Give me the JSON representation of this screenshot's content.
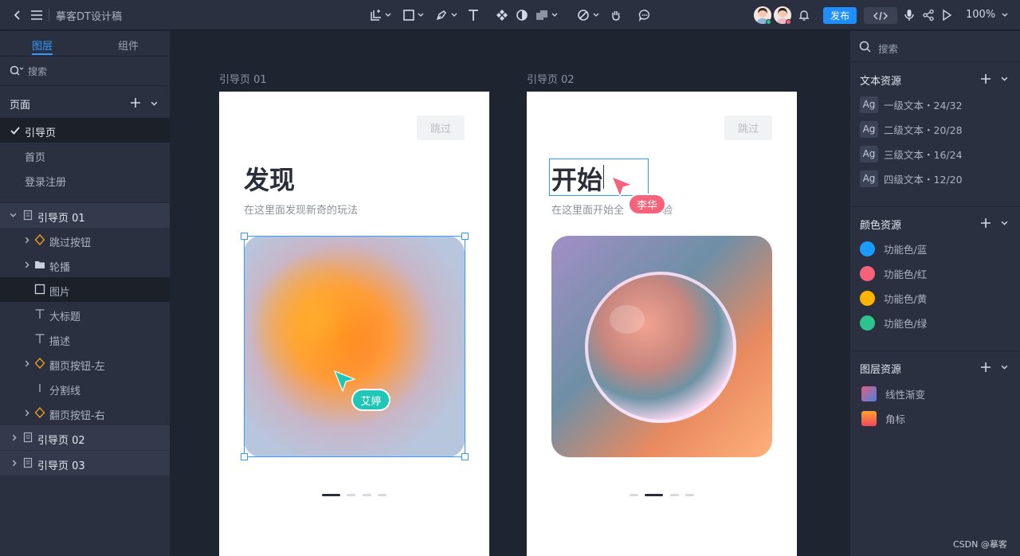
{
  "app": {
    "doc_title": "摹客DT设计稿",
    "publish_label": "发布",
    "zoom": "100%"
  },
  "left_panel": {
    "tabs": [
      "图层",
      "组件"
    ],
    "search_placeholder": "搜索",
    "pages_title": "页面",
    "pages": [
      "引导页",
      "首页",
      "登录注册"
    ],
    "layers": [
      {
        "label": "引导页 01"
      },
      {
        "label": "跳过按钮"
      },
      {
        "label": "轮播"
      },
      {
        "label": "图片"
      },
      {
        "label": "大标题"
      },
      {
        "label": "描述"
      },
      {
        "label": "翻页按钮-左"
      },
      {
        "label": "分割线"
      },
      {
        "label": "翻页按钮-右"
      },
      {
        "label": "引导页 02"
      },
      {
        "label": "引导页 03"
      }
    ]
  },
  "canvas": {
    "frames": [
      {
        "label": "引导页 01",
        "skip": "跳过",
        "title": "发现",
        "desc": "在这里面发现新奇的玩法",
        "cursor_user": "艾婷"
      },
      {
        "label": "引导页 02",
        "skip": "跳过",
        "title": "开始",
        "desc": "在这里面开始全",
        "desc_tail": "验",
        "cursor_user": "李华"
      }
    ]
  },
  "right_panel": {
    "search_placeholder": "搜索",
    "text_assets_title": "文本资源",
    "text_assets": [
      {
        "icon": "Ag",
        "label": "一级文本・24/32"
      },
      {
        "icon": "Ag",
        "label": "二级文本・20/28"
      },
      {
        "icon": "Ag",
        "label": "三级文本・16/24"
      },
      {
        "icon": "Ag",
        "label": "四级文本・12/20"
      }
    ],
    "color_assets_title": "颜色资源",
    "color_assets": [
      {
        "label": "功能色/蓝",
        "color": "#1a9bff"
      },
      {
        "label": "功能色/红",
        "color": "#f5627a"
      },
      {
        "label": "功能色/黄",
        "color": "#ffb400"
      },
      {
        "label": "功能色/绿",
        "color": "#2ec38e"
      }
    ],
    "layer_assets_title": "图层资源",
    "layer_assets": [
      {
        "label": "线性渐变"
      },
      {
        "label": "角标"
      }
    ]
  },
  "watermark": "CSDN @摹客"
}
